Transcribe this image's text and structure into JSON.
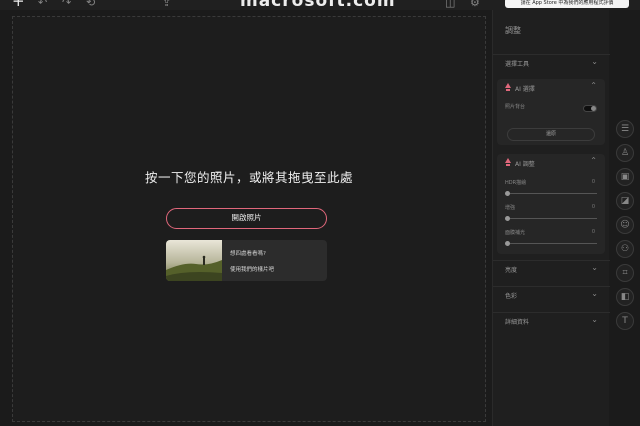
{
  "topbar": {
    "title": "macrosoft.com",
    "appstore_label": "請在 App Store 中為我們的應用程式評價",
    "icons": [
      "plus-icon",
      "undo-icon",
      "redo-icon",
      "reset-icon",
      "share-icon",
      "compare-icon",
      "settings-icon"
    ]
  },
  "canvas": {
    "drop_text": "按一下您的照片，或將其拖曳至此處",
    "open_button": "開啟照片",
    "sample": {
      "question": "想四處看看嗎?",
      "link": "使用我們的樣片吧"
    }
  },
  "panel": {
    "title": "調整",
    "selection_tools": "選擇工具",
    "ai_select": {
      "title": "AI 選擇",
      "photo_bg": "照片背台",
      "restore": "還原"
    },
    "ai_adjust": {
      "title": "AI 調整",
      "rows": [
        {
          "label": "HDR描繪",
          "value": "0",
          "level": 0
        },
        {
          "label": "增強",
          "value": "0",
          "level": 0
        },
        {
          "label": "面膜補光",
          "value": "0",
          "level": 0
        }
      ]
    },
    "sections": [
      {
        "label": "亮度"
      },
      {
        "label": "色彩"
      },
      {
        "label": "詳細資料"
      }
    ]
  },
  "tools": [
    "sliders-icon",
    "portrait-icon",
    "image-icon",
    "crop-square-icon",
    "face-icon",
    "color-circles-icon",
    "crop-icon",
    "layers-icon",
    "text-icon"
  ],
  "colors": {
    "accent": "#e0677b",
    "background": "#1b1b1b"
  }
}
